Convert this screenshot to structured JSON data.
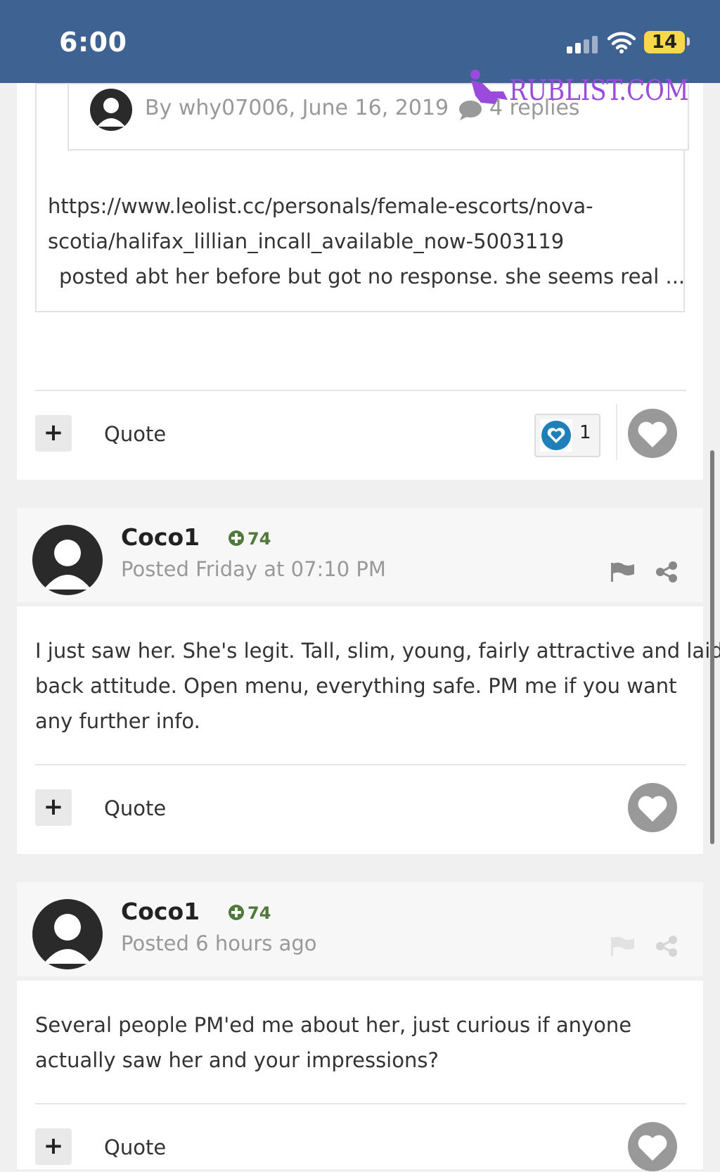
{
  "status_bar": {
    "time": "6:00",
    "battery": "14",
    "colors": {
      "bar": "#3e6292",
      "battery": "#f7d84a"
    }
  },
  "watermark": {
    "text": "RUBLIST.COM",
    "color": "#9b4bdc"
  },
  "embed": {
    "author_line": "By why07006, June 16, 2019",
    "replies": "4 replies",
    "lines": [
      "https://www.leolist.cc/personals/female-escorts/nova-",
      "scotia/halifax_lillian_incall_available_now-5003119",
      "posted abt her before but got no response. she seems real ..."
    ]
  },
  "post1_actions": {
    "plus": "+",
    "quote": "Quote",
    "reaction_count": "1"
  },
  "posts": [
    {
      "author": "Coco1",
      "reputation": "74",
      "posted": "Posted Friday at 07:10 PM",
      "lines": [
        "I just saw her. She's legit. Tall, slim, young, fairly attractive and laid",
        "back attitude. Open menu, everything safe. PM me if you want",
        "any further info."
      ],
      "plus": "+",
      "quote": "Quote"
    },
    {
      "author": "Coco1",
      "reputation": "74",
      "posted": "Posted 6 hours ago",
      "lines": [
        "Several people PM'ed me about her, just curious if anyone",
        "actually saw her and your impressions?"
      ],
      "plus": "+",
      "quote": "Quote"
    }
  ],
  "icons": [
    "signal-icon",
    "wifi-icon",
    "battery-icon",
    "avatar-icon",
    "comment-icon",
    "heart-icon",
    "like-icon",
    "reputation-plus-icon",
    "flag-icon",
    "share-icon"
  ]
}
